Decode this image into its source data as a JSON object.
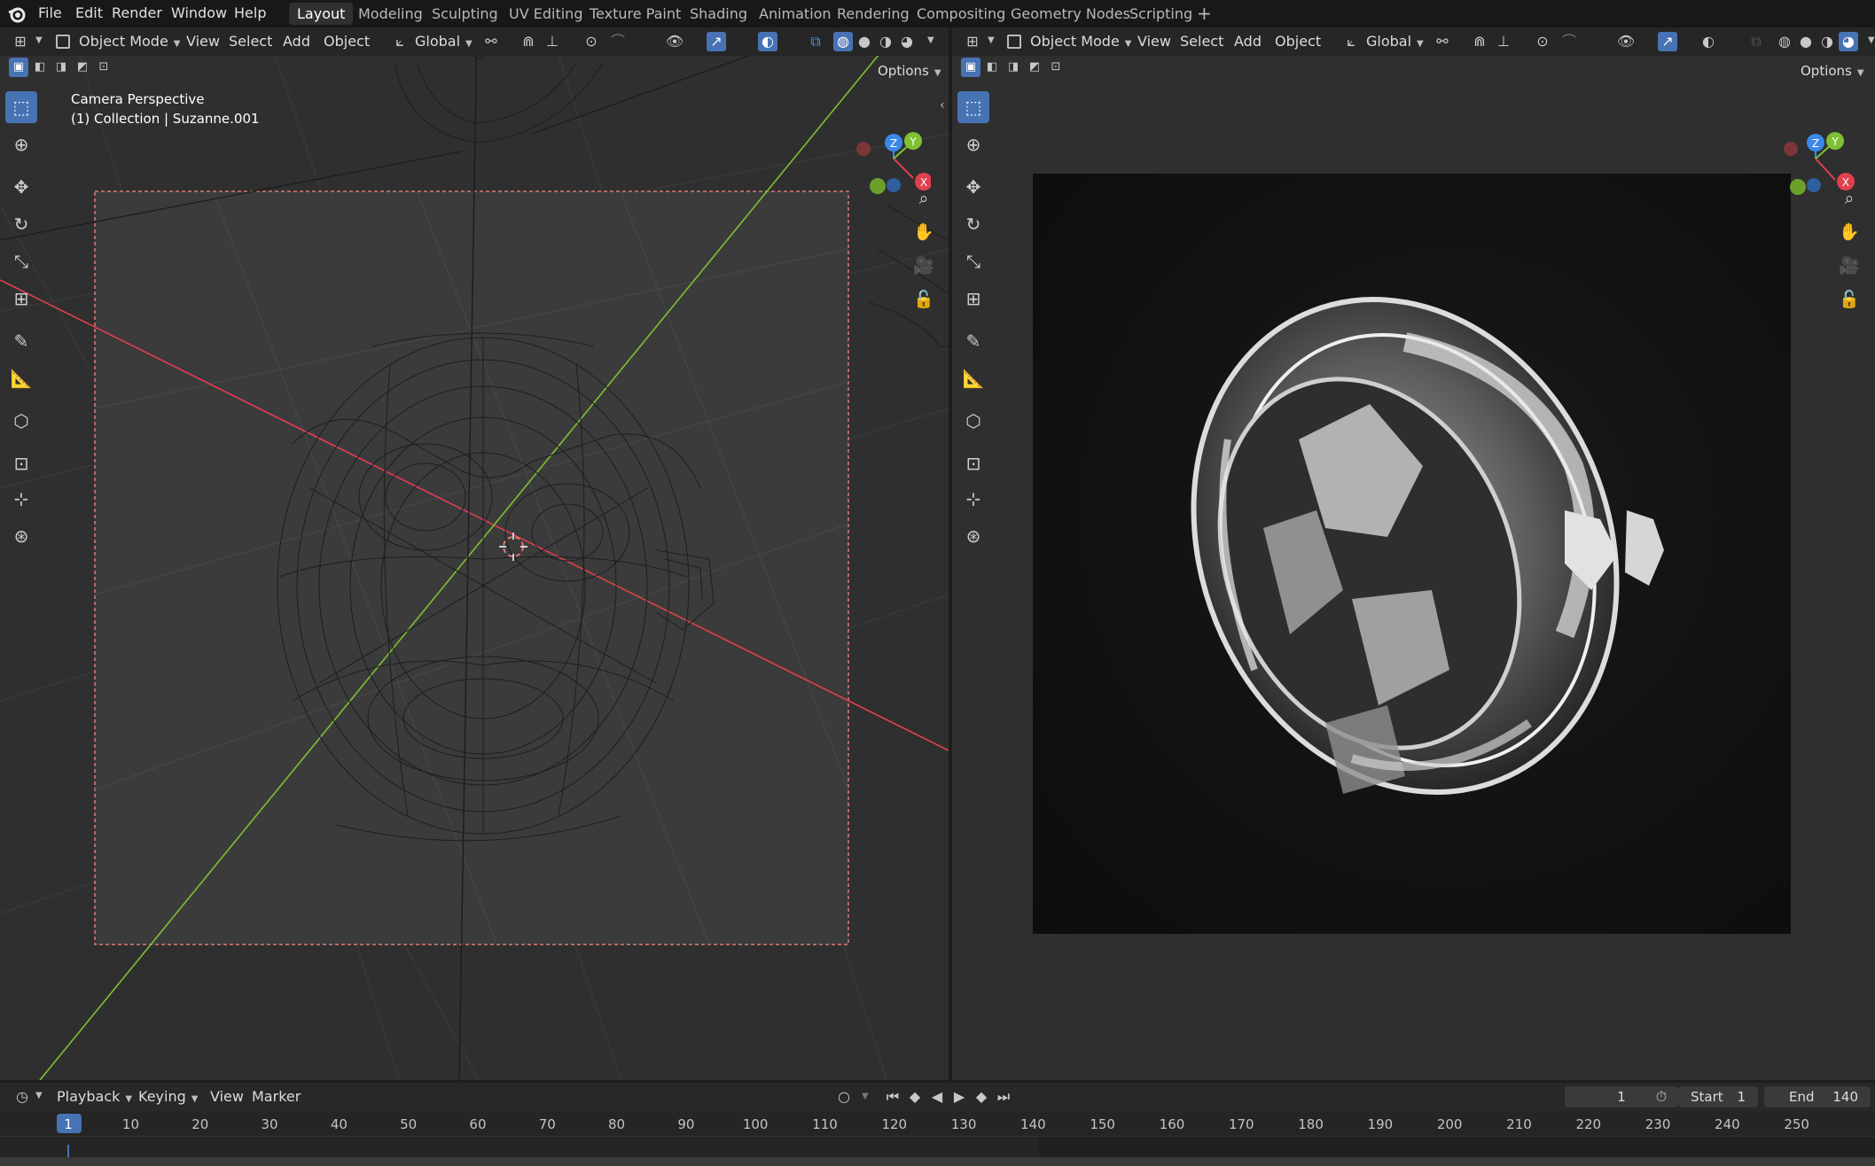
{
  "topbar": {
    "menus": [
      "File",
      "Edit",
      "Render",
      "Window",
      "Help"
    ],
    "workspaces": [
      "Layout",
      "Modeling",
      "Sculpting",
      "UV Editing",
      "Texture Paint",
      "Shading",
      "Animation",
      "Rendering",
      "Compositing",
      "Geometry Nodes",
      "Scripting"
    ],
    "active_workspace": "Layout",
    "add_tab_label": "+"
  },
  "left_viewport": {
    "mode": "Object Mode",
    "menus": [
      "View",
      "Select",
      "Add",
      "Object"
    ],
    "orientation": "Global",
    "options_label": "Options",
    "view_name": "Camera Perspective",
    "collection_label": "(1) Collection | Suzanne.001",
    "gizmo_axes": {
      "x": "X",
      "y": "Y",
      "z": "Z"
    }
  },
  "right_viewport": {
    "mode": "Object Mode",
    "menus": [
      "View",
      "Select",
      "Add",
      "Object"
    ],
    "orientation": "Global",
    "options_label": "Options",
    "gizmo_axes": {
      "x": "X",
      "y": "Y",
      "z": "Z"
    }
  },
  "timeline": {
    "menus": [
      "Playback",
      "Keying",
      "View",
      "Marker"
    ],
    "current_frame": "1",
    "start_label": "Start",
    "start_value": "1",
    "end_label": "End",
    "end_value": "140",
    "ticks": [
      "1",
      "10",
      "20",
      "30",
      "40",
      "50",
      "60",
      "70",
      "80",
      "90",
      "100",
      "110",
      "120",
      "130",
      "140",
      "150",
      "160",
      "170",
      "180",
      "190",
      "200",
      "210",
      "220",
      "230",
      "240",
      "250"
    ]
  },
  "colors": {
    "accent": "#4772b3",
    "axis_x": "#e0404f",
    "axis_y": "#7ec033",
    "axis_z": "#3a88e8",
    "camera_frame": "#e07a7a"
  }
}
